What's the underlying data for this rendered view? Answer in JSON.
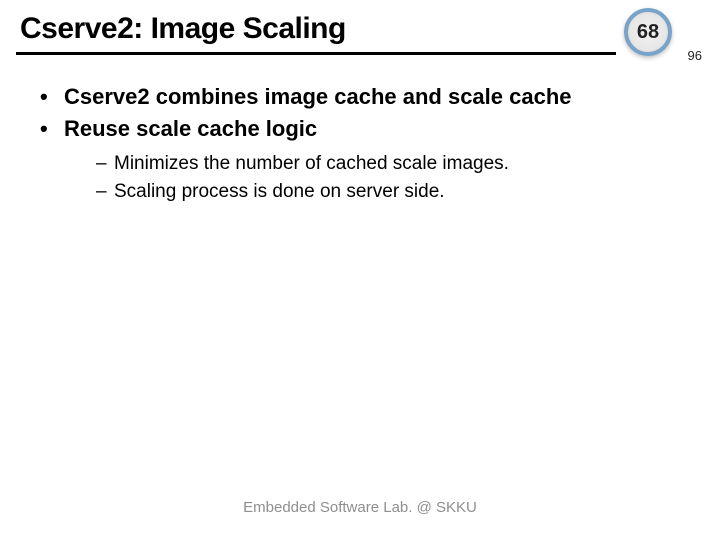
{
  "header": {
    "title": "Cserve2: Image Scaling",
    "page_number": "68",
    "total_pages": "96"
  },
  "bullets": [
    "Cserve2 combines image cache and scale cache",
    "Reuse scale cache logic"
  ],
  "sub_bullets": [
    "Minimizes the number of cached scale images.",
    "Scaling process is done on server side."
  ],
  "footer": "Embedded Software Lab. @ SKKU"
}
